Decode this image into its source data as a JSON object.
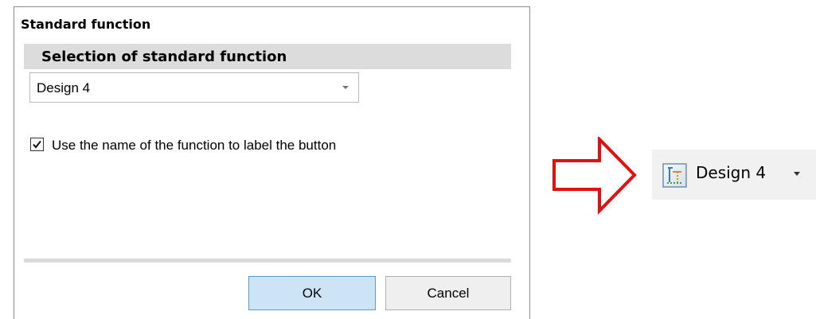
{
  "dialog": {
    "title": "Standard function",
    "section_header": "Selection of standard function",
    "combo": {
      "value": "Design 4",
      "icon": "chevron-down-icon"
    },
    "checkbox": {
      "checked": true,
      "label": "Use the name of the function to label the button"
    },
    "buttons": {
      "ok": "OK",
      "cancel": "Cancel"
    }
  },
  "arrow": {
    "icon": "right-arrow-icon",
    "color": "#e01010"
  },
  "ribbon": {
    "label": "Design 4",
    "icon": "design-function-icon",
    "dropdown_icon": "dropdown-arrow-icon"
  }
}
